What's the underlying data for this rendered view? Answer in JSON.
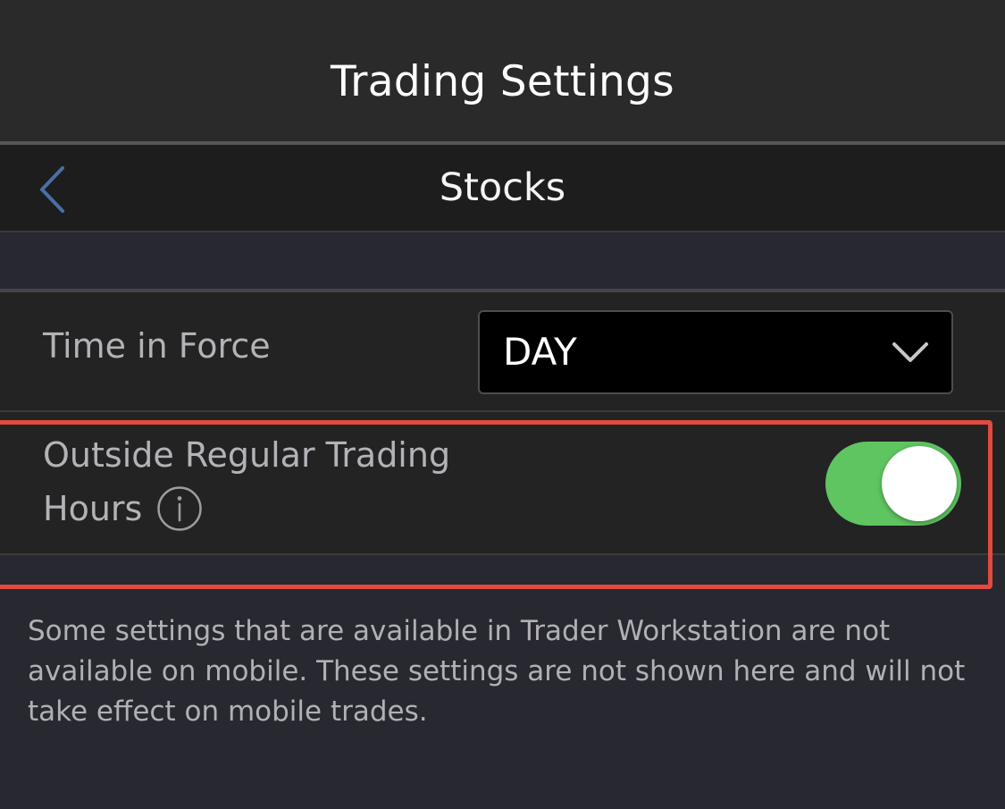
{
  "header": {
    "title": "Trading Settings"
  },
  "nav": {
    "back_icon": "chevron-left-icon",
    "title": "Stocks",
    "accent_color": "#4a6fa5"
  },
  "settings": {
    "time_in_force": {
      "label": "Time in Force",
      "value": "DAY",
      "dropdown_icon": "chevron-down-icon"
    },
    "outside_rth": {
      "label_line1": "Outside Regular Trading",
      "label_line2": "Hours",
      "info_icon": "info-icon",
      "enabled": true,
      "toggle_color": "#5fc561"
    }
  },
  "highlight_color": "#e04a3f",
  "footer": {
    "note": "Some settings that are available in Trader Workstation are not available on mobile. These settings are not shown here and will not take effect on mobile trades."
  }
}
